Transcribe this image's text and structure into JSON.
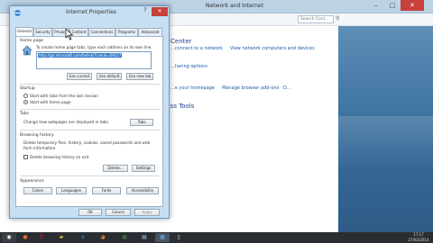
{
  "control_panel": {
    "title": "Network and Internet",
    "search_placeholder": "Search Cont...",
    "heading_center": "Center",
    "link_connect": "...connect to a network",
    "link_view_computers": "View network computers and devices",
    "link_sharing": "...haring options",
    "heading_tools": "...ss Tools",
    "link_homepage": "...e your homepage",
    "link_manage_addons": "Manage browser add-ons",
    "link_delete": "D..."
  },
  "dialog": {
    "title": "Internet Properties",
    "close_glyph": "✕",
    "help_glyph": "?",
    "tabs": [
      "General",
      "Security",
      "Privacy",
      "Content",
      "Connections",
      "Programs",
      "Advanced"
    ],
    "homepage_section": "Home page",
    "homepage_desc": "To create home page tabs, type each address on its own line.",
    "homepage_value": "http://go.microsoft.com/fwlink/?LinkId=69157",
    "btn_use_current": "Use current",
    "btn_use_default": "Use default",
    "btn_use_new_tab": "Use new tab",
    "startup_section": "Startup",
    "startup_option1": "Start with tabs from the last session",
    "startup_option2": "Start with home page",
    "tabs_section": "Tabs",
    "tabs_desc": "Change how webpages are displayed in tabs.",
    "btn_tabs": "Tabs",
    "history_section": "Browsing history",
    "history_desc1": "Delete temporary files, history, cookies, saved passwords and web",
    "history_desc2": "form information.",
    "history_checkbox": "Delete browsing history on exit",
    "btn_delete": "Delete...",
    "btn_settings": "Settings",
    "appearance_section": "Appearance",
    "btn_colors": "Colors",
    "btn_languages": "Languages",
    "btn_fonts": "Fonts",
    "btn_accessibility": "Accessibility",
    "btn_ok": "OK",
    "btn_cancel": "Cancel",
    "btn_apply": "Apply"
  },
  "taskbar": {
    "icons": [
      "start-icon",
      "media-player-icon",
      "opera-icon",
      "explorer-icon",
      "chrome-icon",
      "internet-explorer-icon",
      "firefox-icon",
      "paint-icon",
      "control-panel-icon",
      "notepad-icon"
    ],
    "time": "17:17",
    "date": "27/02/2014"
  },
  "colors": {
    "dialog_frame": "#c6dff2",
    "close_red": "#c8413a",
    "link_blue": "#1e5aa8",
    "selection_blue": "#3178c6"
  }
}
